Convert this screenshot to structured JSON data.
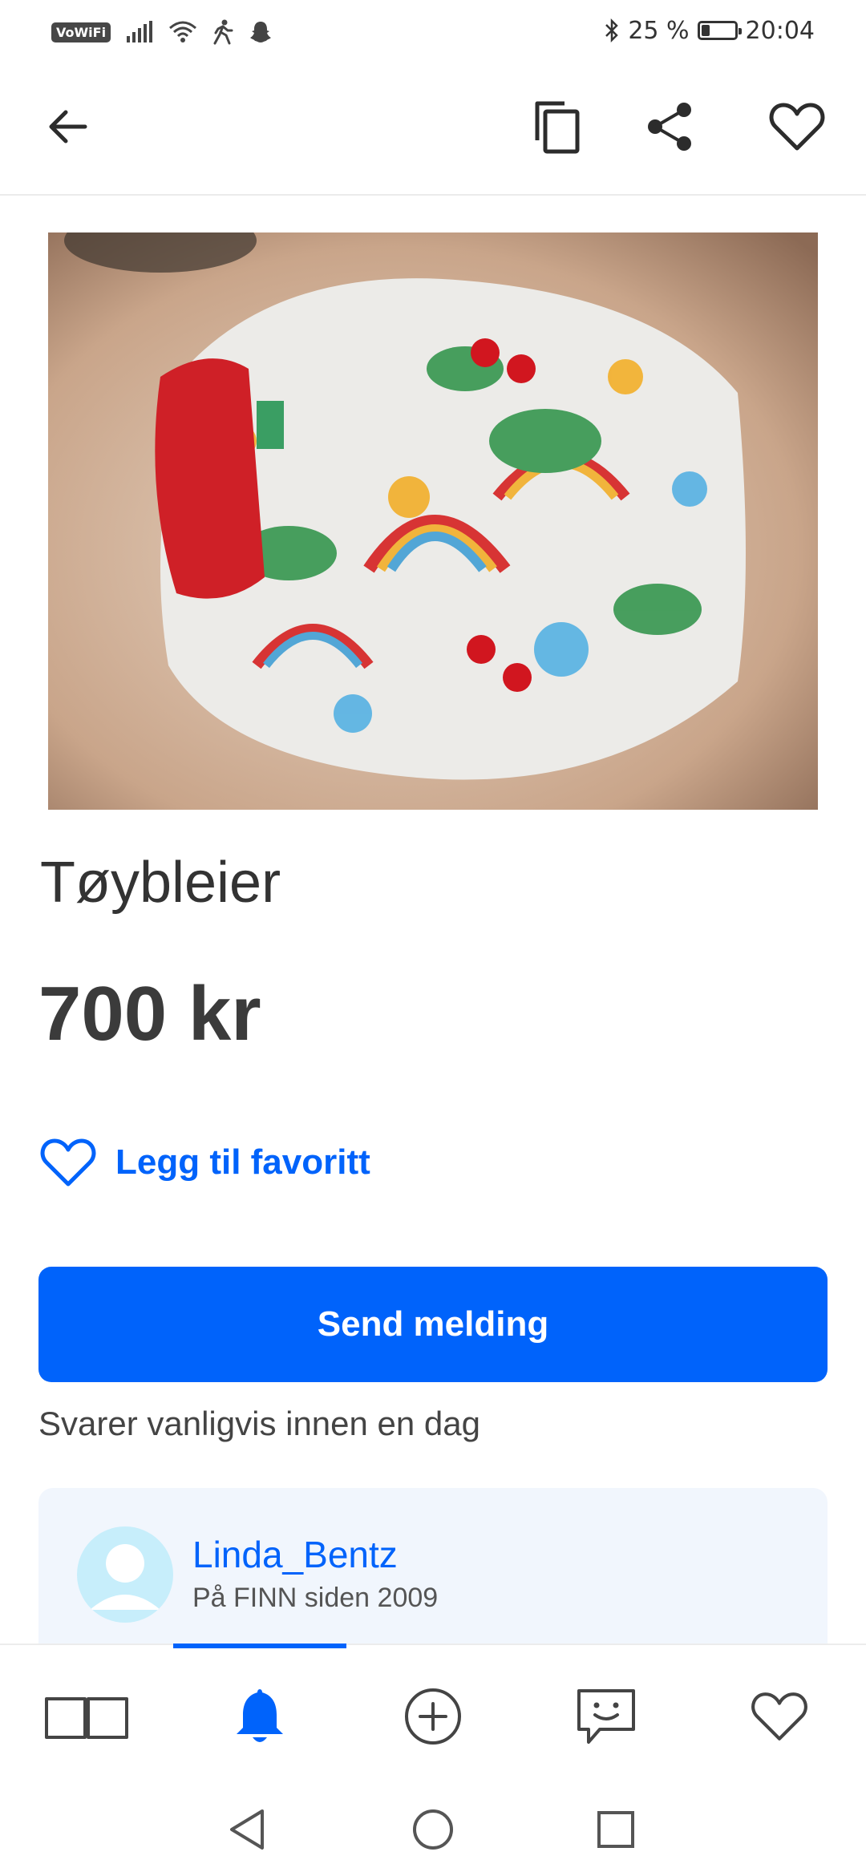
{
  "status_bar": {
    "vowifi": "VoWiFi",
    "battery_text": "25 %",
    "battery_level_percent": 25,
    "time": "20:04"
  },
  "toolbar": {
    "back_icon": "arrow-left-icon",
    "copy_icon": "copy-icon",
    "share_icon": "share-icon",
    "favorite_icon": "heart-outline-icon"
  },
  "listing": {
    "title": "Tøybleier",
    "price": "700 kr",
    "favorite_label": "Legg til favoritt",
    "send_button": "Send melding",
    "reply_note": "Svarer vanligvis innen en dag"
  },
  "seller": {
    "name": "Linda_Bentz",
    "since": "På FINN siden 2009"
  },
  "bottom_nav": {
    "items": [
      "book-icon",
      "bell-icon",
      "plus-circle-icon",
      "chat-icon",
      "heart-icon"
    ],
    "active_index": 1
  },
  "colors": {
    "accent": "#0063fb",
    "seller_card_bg": "#f1f6fd",
    "avatar_bg": "#c7eefb"
  }
}
